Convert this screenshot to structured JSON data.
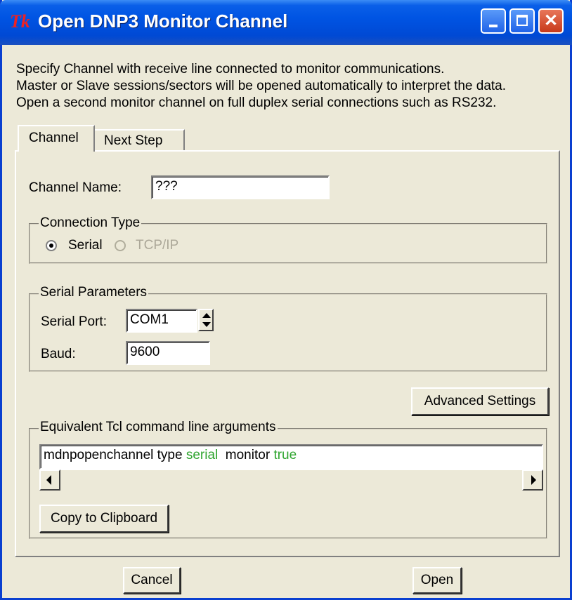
{
  "window": {
    "title": "Open DNP3 Monitor Channel",
    "logo": "Tk",
    "close_glyph": "✕"
  },
  "description": [
    "Specify Channel with receive line connected to monitor communications.",
    "Master or Slave sessions/sectors will be opened automatically to interpret the data.",
    "Open a second monitor channel on full duplex serial connections such as RS232."
  ],
  "tabs": [
    {
      "label": "Channel"
    },
    {
      "label": "Next Step"
    }
  ],
  "channel_name": {
    "label": "Channel Name:",
    "value": "???"
  },
  "connection_type": {
    "legend": "Connection Type",
    "options": [
      "Serial",
      "TCP/IP"
    ]
  },
  "serial_parameters": {
    "legend": "Serial Parameters",
    "port_label": "Serial Port:",
    "port_value": "COM1",
    "baud_label": "Baud:",
    "baud_value": "9600"
  },
  "advanced_settings_label": "Advanced Settings",
  "tcl": {
    "legend": "Equivalent Tcl command line arguments",
    "cmd_prefix": "mdnpopenchannel type ",
    "type_value": "serial",
    "monitor_key": "  monitor ",
    "monitor_value": "true",
    "copy_label": "Copy to Clipboard"
  },
  "footer": {
    "cancel_label": "Cancel",
    "open_label": "Open"
  },
  "colors": {
    "value_green": "#2fa52f",
    "titlebar": "#0054e3"
  }
}
